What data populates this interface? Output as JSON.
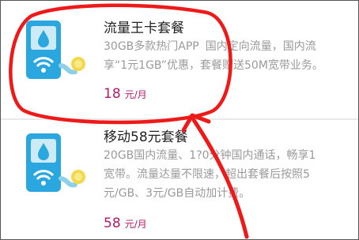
{
  "plans": [
    {
      "title": "流量王卡套餐",
      "desc_lines": [
        "30GB多款热门APP",
        "国内定向流量，国内流",
        "享“1元1GB”优惠，套餐赠送50M宽带业务。"
      ],
      "price": "18",
      "unit": "元/月",
      "icon": "sim-card-wifi-icon"
    },
    {
      "title": "移动58元套餐",
      "desc_lines": [
        "20GB国内流量、",
        "1?0分钟国内通话，畅享1",
        "宽带。流量达量不限速，超出套餐后按照5",
        "元/GB、3元/GB自动加计费。"
      ],
      "price": "58",
      "unit": "元/月",
      "icon": "sim-card-wifi-icon"
    }
  ],
  "colors": {
    "accent_price": "#b31a6e",
    "annotation_red": "#ee1a1a",
    "card_blue": "#2ba7e0"
  }
}
